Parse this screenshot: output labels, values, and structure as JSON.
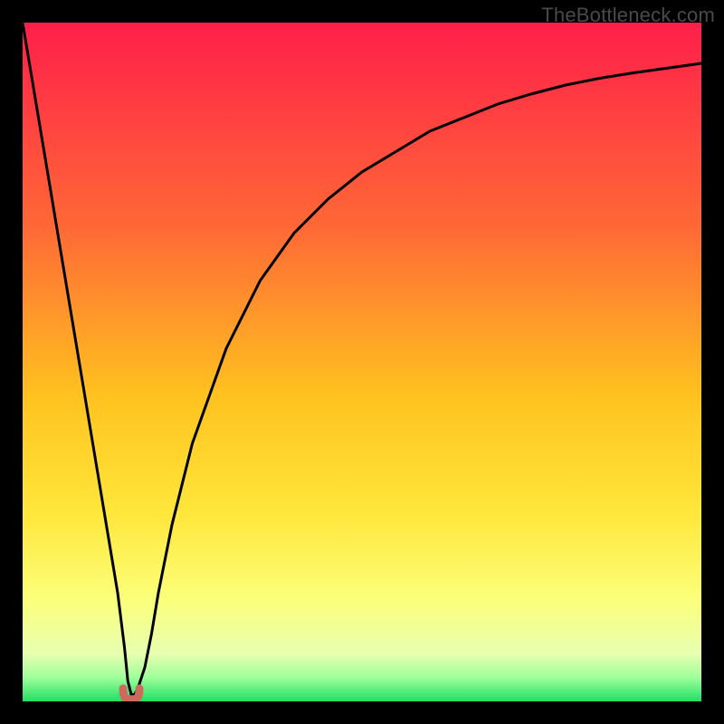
{
  "attribution": "TheBottleneck.com",
  "colors": {
    "top": "#ff1f4a",
    "mid_upper": "#ff7a2e",
    "mid": "#ffd21f",
    "mid_lower": "#fff45a",
    "pale": "#f8ffb0",
    "green_light": "#baff9a",
    "green": "#29e56b",
    "curve": "#000000",
    "nub": "#cc6a5c",
    "frame": "#000000"
  },
  "chart_data": {
    "type": "line",
    "title": "",
    "xlabel": "",
    "ylabel": "",
    "xlim": [
      0,
      100
    ],
    "ylim": [
      0,
      100
    ],
    "series": [
      {
        "name": "bottleneck-curve",
        "x": [
          0,
          2,
          4,
          6,
          8,
          10,
          12,
          14,
          15,
          15.5,
          16,
          16.5,
          17,
          18,
          19,
          20,
          22,
          25,
          30,
          35,
          40,
          45,
          50,
          55,
          60,
          65,
          70,
          75,
          80,
          85,
          90,
          95,
          100
        ],
        "values": [
          100,
          88,
          76,
          64,
          52,
          40,
          28,
          16,
          8,
          3,
          1,
          1,
          2,
          5,
          10,
          16,
          26,
          38,
          52,
          62,
          69,
          74,
          78,
          81,
          84,
          86,
          88,
          89.5,
          90.8,
          91.8,
          92.6,
          93.3,
          94
        ]
      }
    ],
    "annotations": [
      {
        "name": "minimum-nub",
        "x": 16,
        "y": 0.7,
        "shape": "u",
        "color": "#cc6a5c"
      }
    ],
    "background_gradient_stops": [
      {
        "pos": 0.0,
        "color": "#ff1f4a"
      },
      {
        "pos": 0.3,
        "color": "#ff6836"
      },
      {
        "pos": 0.55,
        "color": "#ffc21f"
      },
      {
        "pos": 0.72,
        "color": "#ffe63a"
      },
      {
        "pos": 0.85,
        "color": "#fbff7a"
      },
      {
        "pos": 0.93,
        "color": "#e7ffb0"
      },
      {
        "pos": 0.965,
        "color": "#9fff9a"
      },
      {
        "pos": 1.0,
        "color": "#1fe063"
      }
    ]
  }
}
